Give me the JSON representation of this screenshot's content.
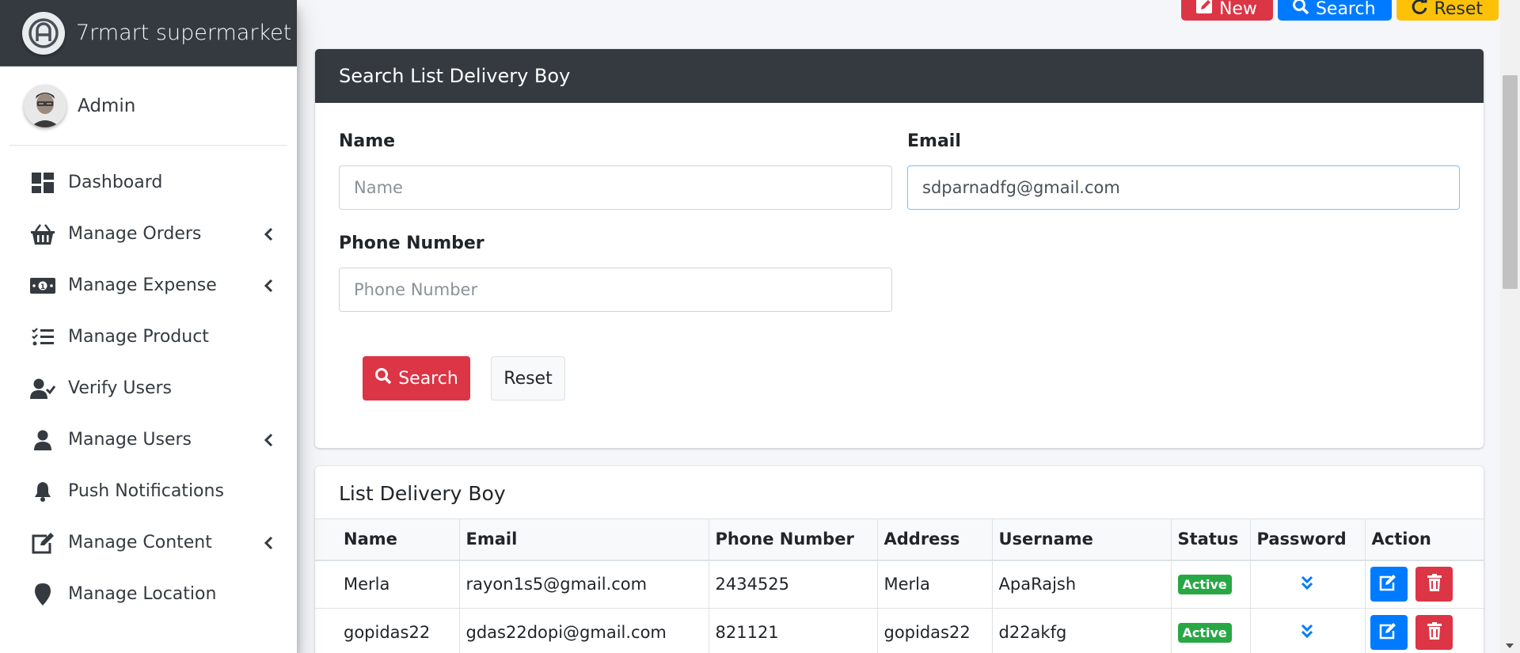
{
  "brand": {
    "name": "7rmart supermarket",
    "icon": "logo-icon"
  },
  "user": {
    "name": "Admin"
  },
  "sidebar": {
    "items": [
      {
        "label": "Dashboard",
        "icon": "dashboard-icon"
      },
      {
        "label": "Manage Orders",
        "icon": "basket-icon",
        "has_submenu": true
      },
      {
        "label": "Manage Expense",
        "icon": "money-icon",
        "has_submenu": true
      },
      {
        "label": "Manage Product",
        "icon": "tasks-icon"
      },
      {
        "label": "Verify Users",
        "icon": "user-check-icon"
      },
      {
        "label": "Manage Users",
        "icon": "user-icon",
        "has_submenu": true
      },
      {
        "label": "Push Notifications",
        "icon": "bell-icon"
      },
      {
        "label": "Manage Content",
        "icon": "edit-icon",
        "has_submenu": true
      },
      {
        "label": "Manage Location",
        "icon": "map-marker-icon"
      }
    ]
  },
  "toolbar": {
    "new_label": "New",
    "search_label": "Search",
    "reset_label": "Reset"
  },
  "search_card": {
    "title": "Search List Delivery Boy",
    "name_label": "Name",
    "name_placeholder": "Name",
    "name_value": "",
    "email_label": "Email",
    "email_value": "sdparnadfg@gmail.com",
    "phone_label": "Phone Number",
    "phone_placeholder": "Phone Number",
    "phone_value": "",
    "search_button": "Search",
    "reset_button": "Reset"
  },
  "list_card": {
    "title": "List Delivery Boy",
    "columns": [
      "Name",
      "Email",
      "Phone Number",
      "Address",
      "Username",
      "Status",
      "Password",
      "Action"
    ],
    "rows": [
      {
        "name": "Merla",
        "email": "rayon1s5@gmail.com",
        "phone": "2434525",
        "address": "Merla",
        "username": "ApaRajsh",
        "status": "Active"
      },
      {
        "name": "gopidas22",
        "email": "gdas22dopi@gmail.com",
        "phone": "821121",
        "address": "gopidas22",
        "username": "d22akfg",
        "status": "Active"
      }
    ]
  },
  "colors": {
    "sidebar_dark": "#343a40",
    "danger": "#dc3545",
    "primary": "#007bff",
    "warning": "#ffc107",
    "success": "#28a745"
  }
}
